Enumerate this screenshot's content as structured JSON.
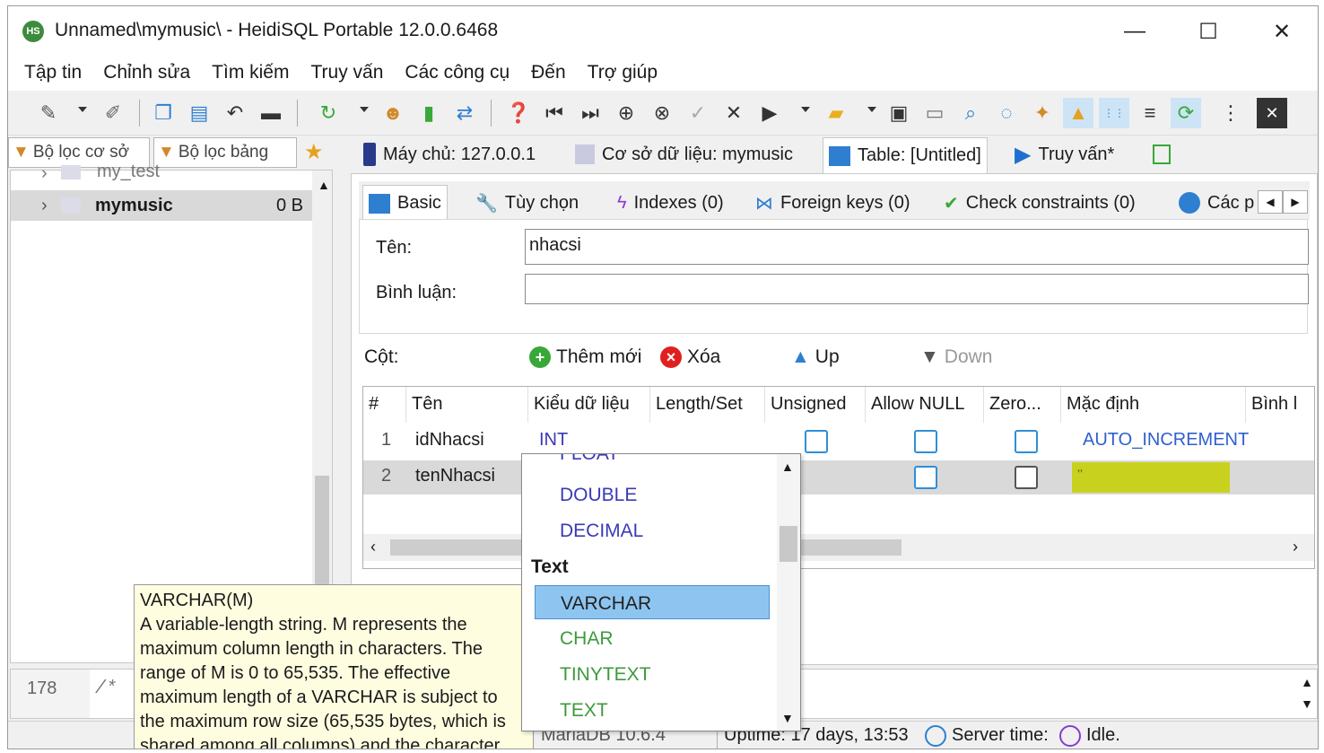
{
  "window": {
    "app_icon": "HS",
    "title": "Unnamed\\mymusic\\ - HeidiSQL Portable 12.0.0.6468",
    "minimize": "—",
    "maximize": "☐",
    "close": "✕"
  },
  "menu": [
    "Tập tin",
    "Chỉnh sửa",
    "Tìm kiếm",
    "Truy vấn",
    "Các công cụ",
    "Đến",
    "Trợ giúp"
  ],
  "left": {
    "filter_db": "Bộ lọc cơ sở",
    "filter_table": "Bộ lọc bảng",
    "tree": [
      {
        "name": "my_test",
        "size": ""
      },
      {
        "name": "mymusic",
        "size": "0 B"
      }
    ]
  },
  "main_tabs": {
    "server": "Máy chủ: 127.0.0.1",
    "database": "Cơ sở dữ liệu: mymusic",
    "table": "Table: [Untitled]",
    "query": "Truy vấn*"
  },
  "sub_tabs": [
    "Basic",
    "Tùy chọn",
    "Indexes (0)",
    "Foreign keys (0)",
    "Check constraints (0)",
    "Các p"
  ],
  "form": {
    "name_label": "Tên:",
    "name_value": "nhacsi",
    "comment_label": "Bình luận:",
    "comment_value": ""
  },
  "columns_bar": {
    "label": "Cột:",
    "add": "Thêm mới",
    "delete": "Xóa",
    "up": "Up",
    "down": "Down"
  },
  "grid": {
    "headers": [
      "#",
      "Tên",
      "Kiểu dữ liệu",
      "Length/Set",
      "Unsigned",
      "Allow NULL",
      "Zero...",
      "Mặc định",
      "Bình l"
    ],
    "rows": [
      {
        "num": "1",
        "name": "idNhacsi",
        "type": "INT",
        "length": "",
        "unsigned": false,
        "allow_null": false,
        "zerofill": false,
        "default": "AUTO_INCREMENT"
      },
      {
        "num": "2",
        "name": "tenNhacsi",
        "type": "",
        "length": "",
        "unsigned": false,
        "allow_null": false,
        "zerofill": false,
        "default": "''"
      }
    ]
  },
  "dropdown": {
    "items": [
      {
        "label": "FLOAT",
        "kind": "numeric"
      },
      {
        "label": "DOUBLE",
        "kind": "numeric"
      },
      {
        "label": "DECIMAL",
        "kind": "numeric"
      },
      {
        "label": "Text",
        "kind": "group"
      },
      {
        "label": "VARCHAR",
        "kind": "text",
        "selected": true
      },
      {
        "label": "CHAR",
        "kind": "text"
      },
      {
        "label": "TINYTEXT",
        "kind": "text"
      },
      {
        "label": "TEXT",
        "kind": "text"
      }
    ]
  },
  "tooltip": {
    "title": "VARCHAR(M)",
    "lines": [
      "A variable-length string. M represents the",
      "maximum column length in characters. The",
      "range of M is 0 to 65,535. The effective",
      "maximum length of a VARCHAR is subject to",
      "the maximum row size (65,535 bytes, which is",
      "shared among all columns) and the character"
    ]
  },
  "query": {
    "line_number": "178",
    "code": "/* "
  },
  "status": {
    "version": "MariaDB 10.6.4",
    "uptime": "Uptime: 17 days, 13:53",
    "server_time": "Server time:",
    "state": "Idle."
  },
  "colors": {
    "accent_blue": "#2f8fd8",
    "type_numeric": "#3a3ab8",
    "type_text": "#3d9a3d",
    "selected_bg": "#8ec5f0",
    "default_highlight": "#c8d21e",
    "tooltip_bg": "#fffde0"
  }
}
